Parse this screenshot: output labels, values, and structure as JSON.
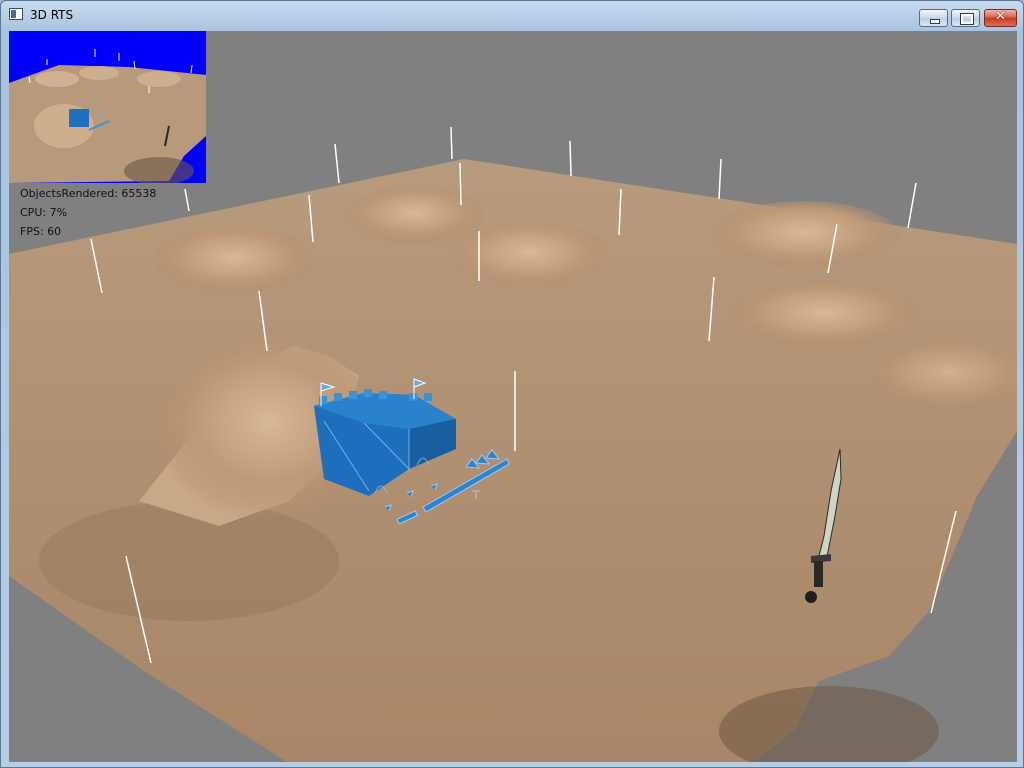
{
  "window": {
    "title": "3D RTS",
    "close_glyph": "✕"
  },
  "colors": {
    "viewport_bg": "#808080",
    "terrain": "#b48f6e",
    "castle": "#1b73bf",
    "minimap_bg": "#0000ff"
  },
  "hud": {
    "objects_rendered": "ObjectsRendered: 65538",
    "cpu": "CPU: 7%",
    "fps": "FPS: 60"
  },
  "icons": [
    "app-icon",
    "minimize-icon",
    "maximize-icon",
    "close-icon",
    "flag-icon",
    "sword-icon"
  ]
}
